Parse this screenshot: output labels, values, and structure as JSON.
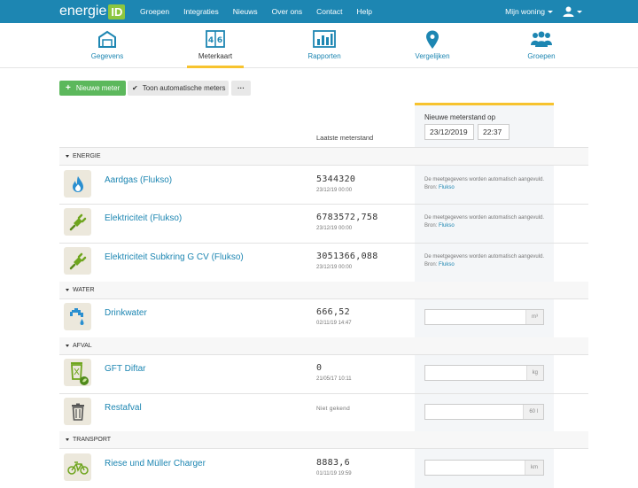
{
  "brand": {
    "text": "energie",
    "box": "ID"
  },
  "nav": {
    "links": [
      "Groepen",
      "Integraties",
      "Nieuws",
      "Over ons",
      "Contact",
      "Help"
    ],
    "home_menu": "Mijn woning"
  },
  "tabs": [
    {
      "label": "Gegevens",
      "icon": "house-icon"
    },
    {
      "label": "Meterkaart",
      "icon": "meter-icon"
    },
    {
      "label": "Rapporten",
      "icon": "bar-chart-icon"
    },
    {
      "label": "Vergelijken",
      "icon": "map-pin-icon"
    },
    {
      "label": "Groepen",
      "icon": "users-icon"
    }
  ],
  "toolbar": {
    "new_meter": "Nieuwe meter",
    "show_auto": "Toon automatische meters",
    "more": "···"
  },
  "panel": {
    "title": "Nieuwe meterstand op",
    "date": "23/12/2019",
    "time": "22:37"
  },
  "columns": {
    "last_reading": "Laatste meterstand"
  },
  "sections": [
    {
      "title": "ENERGIE"
    },
    {
      "title": "WATER"
    },
    {
      "title": "AFVAL"
    },
    {
      "title": "TRANSPORT"
    }
  ],
  "auto_note": {
    "text": "De meetgegevens worden automatisch aangevuld. Bron:",
    "source": "Flukso"
  },
  "meters": [
    {
      "name": "Aardgas (Flukso)",
      "value": "5344320",
      "date": "23/12/19 00:00",
      "icon": "gas-flame-icon"
    },
    {
      "name": "Elektriciteit (Flukso)",
      "value": "6783572,758",
      "date": "23/12/19 00:00",
      "icon": "plug-icon"
    },
    {
      "name": "Elektriciteit Subkring G CV (Flukso)",
      "value": "3051366,088",
      "date": "23/12/19 00:00",
      "icon": "plug-icon"
    },
    {
      "name": "Drinkwater",
      "value": "666,52",
      "date": "02/11/19 14:47",
      "icon": "water-tap-icon",
      "unit": "m³"
    },
    {
      "name": "GFT Diftar",
      "value": "0",
      "date": "21/05/17 10:11",
      "icon": "green-bin-icon",
      "unit": "kg"
    },
    {
      "name": "Restafval",
      "value": "Niet gekend",
      "date": "",
      "icon": "trash-bin-icon",
      "unit": "60 l"
    },
    {
      "name": "Riese und Müller Charger",
      "value": "8883,6",
      "date": "01/11/19 19:59",
      "icon": "bicycle-icon",
      "unit": "km"
    }
  ],
  "colors": {
    "navbar": "#1d86b2",
    "accent": "#f7c32e",
    "green": "#5cb85c",
    "link": "#1d86b2"
  }
}
